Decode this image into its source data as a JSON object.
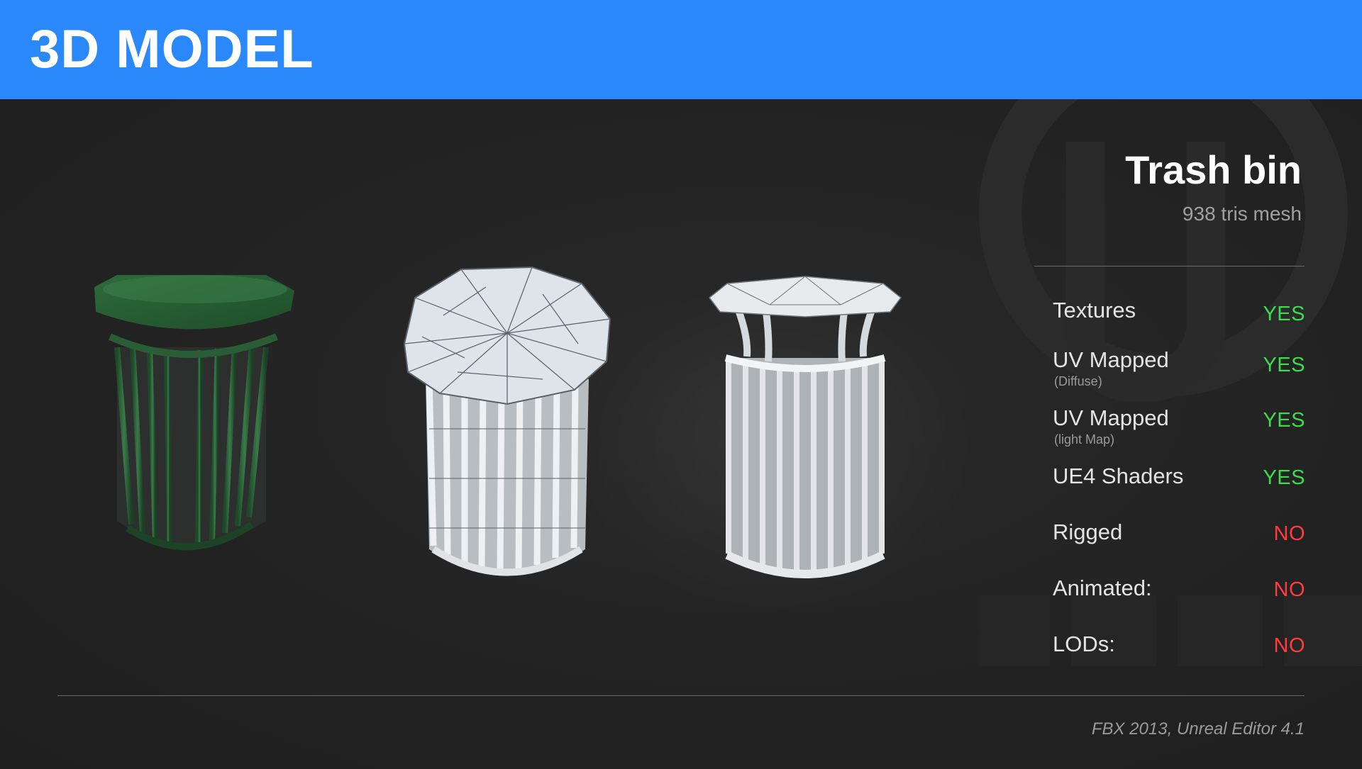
{
  "header": {
    "title": "3D MODEL"
  },
  "model": {
    "name": "Trash bin",
    "subtitle": "938 tris mesh"
  },
  "features": [
    {
      "label": "Textures",
      "note": "",
      "value": "YES",
      "status": "yes"
    },
    {
      "label": "UV Mapped",
      "note": "(Diffuse)",
      "value": "YES",
      "status": "yes"
    },
    {
      "label": "UV Mapped",
      "note": "(light Map)",
      "value": "YES",
      "status": "yes"
    },
    {
      "label": "UE4 Shaders",
      "note": "",
      "value": "YES",
      "status": "yes"
    },
    {
      "label": "Rigged",
      "note": "",
      "value": "NO",
      "status": "no"
    },
    {
      "label": "Animated:",
      "note": "",
      "value": "NO",
      "status": "no"
    },
    {
      "label": "LODs:",
      "note": "",
      "value": "NO",
      "status": "no"
    }
  ],
  "footer": {
    "note": "FBX 2013, Unreal Editor 4.1"
  },
  "colors": {
    "header_bg": "#2a88fb",
    "yes": "#3ddc4c",
    "no": "#ff3b3b",
    "bin_textured": "#2f6b3d",
    "bin_clay": "#c9ced3"
  },
  "renders": [
    {
      "name": "textured-render"
    },
    {
      "name": "wireframe-render"
    },
    {
      "name": "clay-render"
    }
  ]
}
